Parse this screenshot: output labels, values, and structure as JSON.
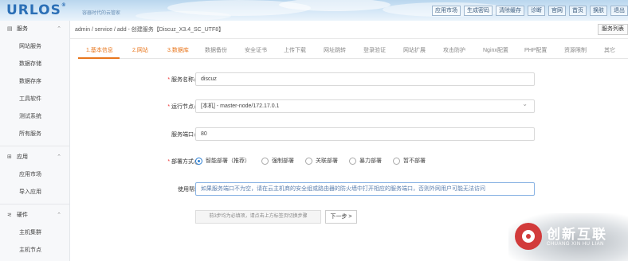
{
  "header": {
    "logo": "URLOS",
    "logo_mark": "®",
    "slogan": "容器时代的云管家",
    "links": [
      "应用市场",
      "生成密码",
      "清除缓存",
      "诊断",
      "官网",
      "首页",
      "换肤",
      "退出"
    ]
  },
  "sidebar": {
    "sections": [
      {
        "label": "服务",
        "icon": "server-icon",
        "items": [
          "网站服务",
          "数据存储",
          "数据存序",
          "工具软件",
          "测试系统",
          "所有服务"
        ]
      },
      {
        "label": "应用",
        "icon": "grid-icon",
        "items": [
          "应用市场",
          "导入应用"
        ]
      },
      {
        "label": "硬件",
        "icon": "share-icon",
        "items": [
          "主机集群",
          "主机节点"
        ]
      }
    ]
  },
  "breadcrumb": "admin / service / add - 创建服务【Discuz_X3.4_SC_UTF8】",
  "list_button": "服务列表",
  "tabs": [
    "1.基本信息",
    "2.网站",
    "3.数据库",
    "数据备份",
    "安全证书",
    "上传下载",
    "网址跳转",
    "登录验证",
    "网站扩展",
    "攻击防护",
    "Nginx配置",
    "PHP配置",
    "资源限制",
    "其它"
  ],
  "form": {
    "service_name": {
      "label": "服务名称",
      "value": "discuz"
    },
    "run_node": {
      "label": "运行节点",
      "value": "[本机] - master-node/172.17.0.1"
    },
    "service_port": {
      "label": "服务端口",
      "value": "80"
    },
    "deploy_mode": {
      "label": "部署方式",
      "options": [
        "智能部署（推荐）",
        "强制部署",
        "关联部署",
        "暴力部署",
        "暂不部署"
      ],
      "selected": 0
    },
    "help": {
      "label": "使用帮助:",
      "value": "如果服务端口不为空，请在云主机商的安全组或路由器的防火墙中打开相应的服务端口，否则外网用户可能无法访问"
    },
    "hint": "前3步均为必填项，请点击上方标签页切换步骤",
    "next_button": "下一步 >"
  },
  "watermark": {
    "cn": "创新互联",
    "en": "CHUANG XIN HU LIAN"
  },
  "colors": {
    "accent": "#e8761c",
    "brand": "#2b6fb6",
    "radio": "#2b7fd3"
  }
}
